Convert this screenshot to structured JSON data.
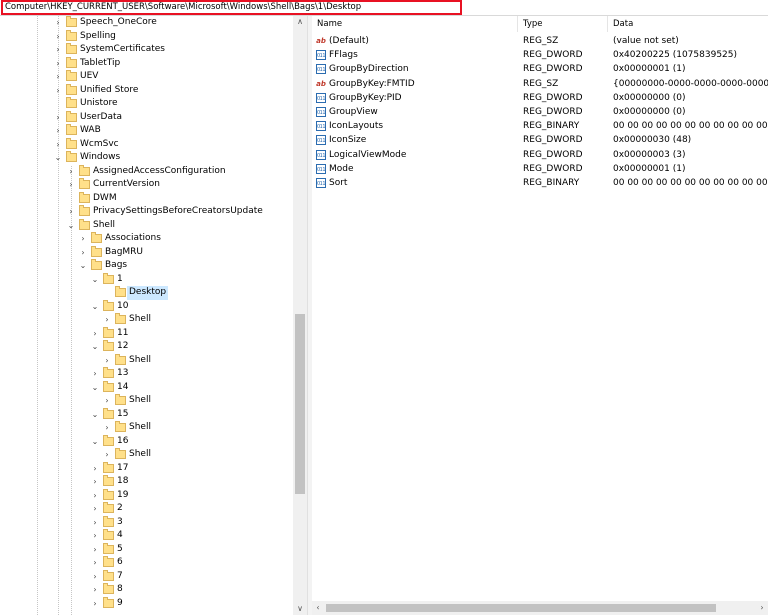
{
  "address_bar": {
    "path": "Computer\\HKEY_CURRENT_USER\\Software\\Microsoft\\Windows\\Shell\\Bags\\1\\Desktop"
  },
  "tree": {
    "items": [
      {
        "label": "Speech_OneCore",
        "depth": 0,
        "expander": "collapsed"
      },
      {
        "label": "Spelling",
        "depth": 0,
        "expander": "collapsed"
      },
      {
        "label": "SystemCertificates",
        "depth": 0,
        "expander": "collapsed"
      },
      {
        "label": "TabletTip",
        "depth": 0,
        "expander": "collapsed"
      },
      {
        "label": "UEV",
        "depth": 0,
        "expander": "collapsed"
      },
      {
        "label": "Unified Store",
        "depth": 0,
        "expander": "collapsed"
      },
      {
        "label": "Unistore",
        "depth": 0,
        "expander": "none"
      },
      {
        "label": "UserData",
        "depth": 0,
        "expander": "collapsed"
      },
      {
        "label": "WAB",
        "depth": 0,
        "expander": "collapsed"
      },
      {
        "label": "WcmSvc",
        "depth": 0,
        "expander": "collapsed"
      },
      {
        "label": "Windows",
        "depth": 0,
        "expander": "expanded"
      },
      {
        "label": "AssignedAccessConfiguration",
        "depth": 1,
        "expander": "collapsed"
      },
      {
        "label": "CurrentVersion",
        "depth": 1,
        "expander": "collapsed"
      },
      {
        "label": "DWM",
        "depth": 1,
        "expander": "none"
      },
      {
        "label": "PrivacySettingsBeforeCreatorsUpdate",
        "depth": 1,
        "expander": "collapsed"
      },
      {
        "label": "Shell",
        "depth": 1,
        "expander": "expanded"
      },
      {
        "label": "Associations",
        "depth": 2,
        "expander": "collapsed"
      },
      {
        "label": "BagMRU",
        "depth": 2,
        "expander": "collapsed"
      },
      {
        "label": "Bags",
        "depth": 2,
        "expander": "expanded"
      },
      {
        "label": "1",
        "depth": 3,
        "expander": "expanded"
      },
      {
        "label": "Desktop",
        "depth": 4,
        "expander": "none",
        "selected": true
      },
      {
        "label": "10",
        "depth": 3,
        "expander": "expanded"
      },
      {
        "label": "Shell",
        "depth": 4,
        "expander": "collapsed"
      },
      {
        "label": "11",
        "depth": 3,
        "expander": "collapsed"
      },
      {
        "label": "12",
        "depth": 3,
        "expander": "expanded"
      },
      {
        "label": "Shell",
        "depth": 4,
        "expander": "collapsed"
      },
      {
        "label": "13",
        "depth": 3,
        "expander": "collapsed"
      },
      {
        "label": "14",
        "depth": 3,
        "expander": "expanded"
      },
      {
        "label": "Shell",
        "depth": 4,
        "expander": "collapsed"
      },
      {
        "label": "15",
        "depth": 3,
        "expander": "expanded"
      },
      {
        "label": "Shell",
        "depth": 4,
        "expander": "collapsed"
      },
      {
        "label": "16",
        "depth": 3,
        "expander": "expanded"
      },
      {
        "label": "Shell",
        "depth": 4,
        "expander": "collapsed"
      },
      {
        "label": "17",
        "depth": 3,
        "expander": "collapsed"
      },
      {
        "label": "18",
        "depth": 3,
        "expander": "collapsed"
      },
      {
        "label": "19",
        "depth": 3,
        "expander": "collapsed"
      },
      {
        "label": "2",
        "depth": 3,
        "expander": "collapsed"
      },
      {
        "label": "3",
        "depth": 3,
        "expander": "collapsed"
      },
      {
        "label": "4",
        "depth": 3,
        "expander": "collapsed"
      },
      {
        "label": "5",
        "depth": 3,
        "expander": "collapsed"
      },
      {
        "label": "6",
        "depth": 3,
        "expander": "collapsed"
      },
      {
        "label": "7",
        "depth": 3,
        "expander": "collapsed"
      },
      {
        "label": "8",
        "depth": 3,
        "expander": "collapsed"
      },
      {
        "label": "9",
        "depth": 3,
        "expander": "collapsed"
      }
    ]
  },
  "values_list": {
    "columns": [
      "Name",
      "Type",
      "Data"
    ],
    "rows": [
      {
        "icon": "string-value-icon",
        "name": "(Default)",
        "type": "REG_SZ",
        "data": "(value not set)"
      },
      {
        "icon": "binary-value-icon",
        "name": "FFlags",
        "type": "REG_DWORD",
        "data": "0x40200225 (1075839525)"
      },
      {
        "icon": "binary-value-icon",
        "name": "GroupByDirection",
        "type": "REG_DWORD",
        "data": "0x00000001 (1)"
      },
      {
        "icon": "string-value-icon",
        "name": "GroupByKey:FMTID",
        "type": "REG_SZ",
        "data": "{00000000-0000-0000-0000-000000000000}"
      },
      {
        "icon": "binary-value-icon",
        "name": "GroupByKey:PID",
        "type": "REG_DWORD",
        "data": "0x00000000 (0)"
      },
      {
        "icon": "binary-value-icon",
        "name": "GroupView",
        "type": "REG_DWORD",
        "data": "0x00000000 (0)"
      },
      {
        "icon": "binary-value-icon",
        "name": "IconLayouts",
        "type": "REG_BINARY",
        "data": "00 00 00 00 00 00 00 00 00 00 00 00 00 00 00 00"
      },
      {
        "icon": "binary-value-icon",
        "name": "IconSize",
        "type": "REG_DWORD",
        "data": "0x00000030 (48)"
      },
      {
        "icon": "binary-value-icon",
        "name": "LogicalViewMode",
        "type": "REG_DWORD",
        "data": "0x00000003 (3)"
      },
      {
        "icon": "binary-value-icon",
        "name": "Mode",
        "type": "REG_DWORD",
        "data": "0x00000001 (1)"
      },
      {
        "icon": "binary-value-icon",
        "name": "Sort",
        "type": "REG_BINARY",
        "data": "00 00 00 00 00 00 00 00 00 00 00 00 00 00 00 00"
      }
    ]
  },
  "glyphs": {
    "expanded": "⌄",
    "collapsed": "›",
    "up": "∧",
    "down": "∨",
    "left": "‹",
    "right": "›",
    "string_icon": "ab",
    "binary_icon": "011"
  }
}
